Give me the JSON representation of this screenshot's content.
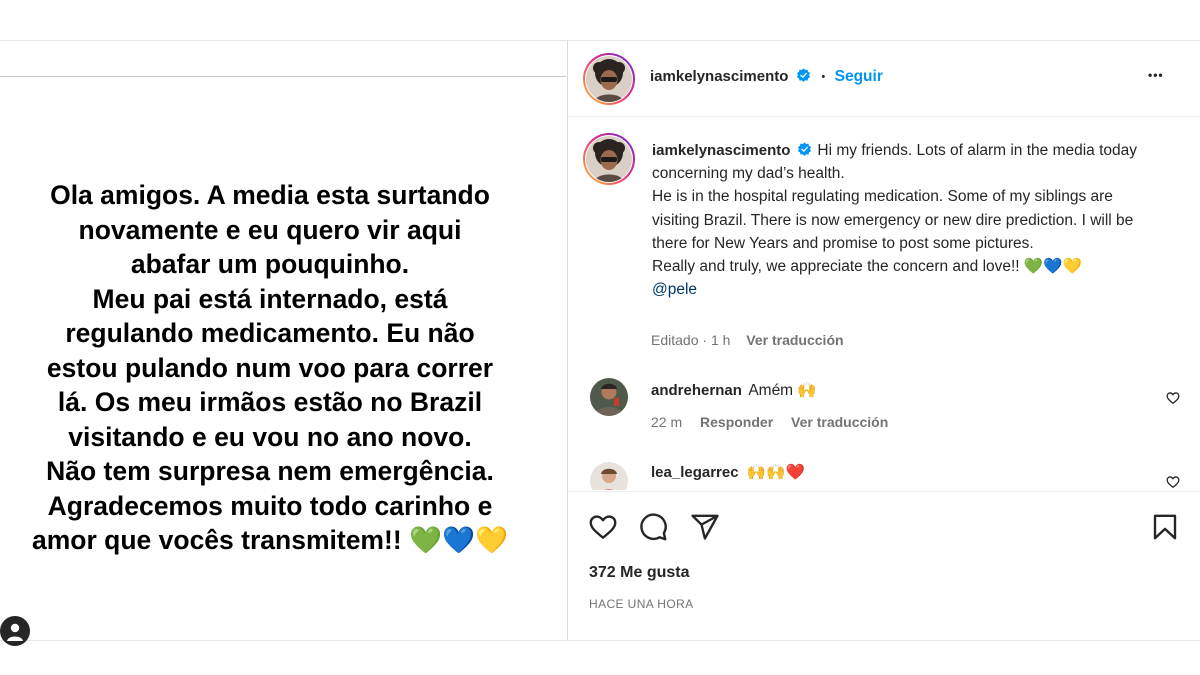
{
  "story": {
    "text": "Ola amigos. A media esta surtando\nnovamente e eu quero vir aqui\nabafar um pouquinho.\nMeu pai está internado, está\nregulando medicamento. Eu não\nestou pulando num voo para correr\nlá. Os meu irmãos estão no Brazil\nvisitando e eu vou no ano novo.\nNão tem surpresa nem emergência.\nAgradecemos muito todo carinho e\namor que vocês transmitem!! 💚💙💛"
  },
  "header": {
    "username": "iamkelynascimento",
    "dot": "•",
    "follow_label": "Seguir",
    "more_label": "•••"
  },
  "caption": {
    "username": "iamkelynascimento",
    "lines": [
      "Hi my friends. Lots of alarm in the media today concerning my dad’s health.",
      "He is in the hospital regulating medication. Some of my siblings are visiting Brazil. There is now emergency or new dire prediction. I will be there for New Years and promise to post some pictures.",
      "Really and truly, we appreciate the concern and love!! 💚💙💛"
    ],
    "mention": "@pele",
    "edited": "Editado",
    "time": "1 h",
    "translate": "Ver traducción"
  },
  "comments": [
    {
      "username": "andrehernan",
      "text": "Amém 🙌",
      "time": "22 m",
      "reply": "Responder",
      "translate": "Ver traducción"
    },
    {
      "username": "lea_legarrec",
      "text": "🙌🙌❤️"
    }
  ],
  "likes": "372 Me gusta",
  "posted_ago": "HACE UNA HORA",
  "colors": {
    "link": "#0095f6",
    "verified": "#0095f6",
    "text": "#262626",
    "muted": "#737373"
  }
}
